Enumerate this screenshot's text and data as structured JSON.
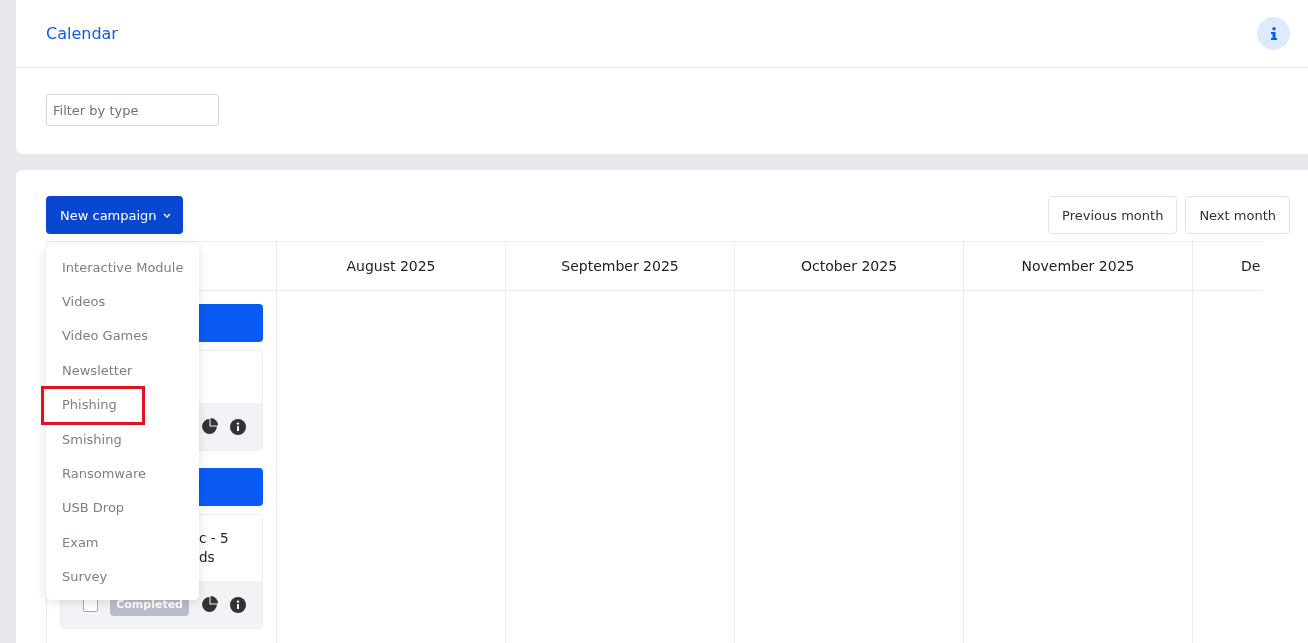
{
  "header": {
    "title": "Calendar",
    "filter": {
      "placeholder": "Filter by type"
    }
  },
  "toolbar": {
    "new_campaign": "New campaign",
    "previous": "Previous month",
    "next": "Next month"
  },
  "calendar": {
    "columns": [
      {},
      {
        "label": "August 2025"
      },
      {
        "label": "September 2025"
      },
      {
        "label": "October 2025"
      },
      {
        "label": "November 2025"
      },
      {
        "label": "De"
      }
    ],
    "campaigns": [
      {
        "kind": "campaign"
      },
      {
        "kind": "campaign",
        "lines": [
          "c - 5",
          "ds"
        ],
        "checked": false,
        "status": "Completed"
      }
    ]
  },
  "dropdown": [
    {
      "label": "Interactive Module",
      "highlighted": false
    },
    {
      "label": "Videos",
      "highlighted": false
    },
    {
      "label": "Video Games",
      "highlighted": false
    },
    {
      "label": "Newsletter",
      "highlighted": false
    },
    {
      "label": "Phishing",
      "highlighted": true
    },
    {
      "label": "Smishing",
      "highlighted": false
    },
    {
      "label": "Ransomware",
      "highlighted": false
    },
    {
      "label": "USB Drop",
      "highlighted": false
    },
    {
      "label": "Exam",
      "highlighted": false
    },
    {
      "label": "Survey",
      "highlighted": false
    }
  ]
}
